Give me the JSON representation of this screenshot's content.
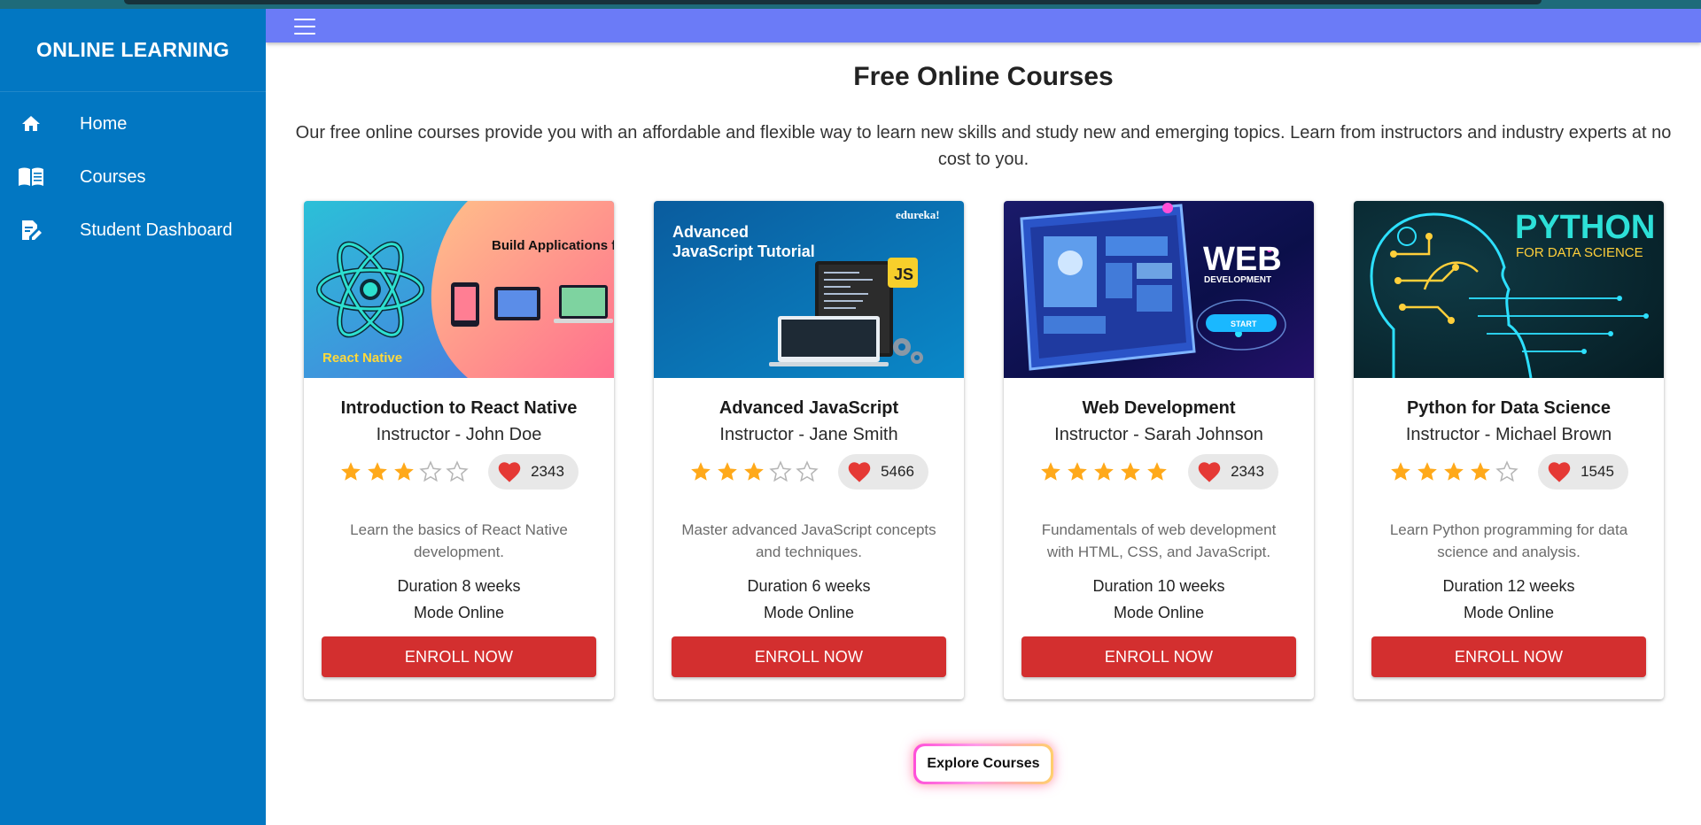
{
  "sidebar": {
    "brand": "ONLINE LEARNING",
    "items": [
      {
        "label": "Home",
        "icon": "home-icon"
      },
      {
        "label": "Courses",
        "icon": "book-icon"
      },
      {
        "label": "Student Dashboard",
        "icon": "edit-note-icon"
      }
    ]
  },
  "appbar": {
    "menu_icon": "menu-icon"
  },
  "main": {
    "title": "Free Online Courses",
    "intro": "Our free online courses provide you with an affordable and flexible way to learn new skills and study new and emerging topics. Learn from instructors and industry experts at no cost to you."
  },
  "courses": [
    {
      "title": "Introduction to React Native",
      "instructor": "Instructor - John Doe",
      "rating": 3,
      "likes": "2343",
      "description": "Learn the basics of React Native development.",
      "duration": "Duration 8 weeks",
      "mode": "Mode Online",
      "enroll_label": "ENROLL NOW",
      "image": {
        "headline": "Build Applications for",
        "caption": "React Native"
      }
    },
    {
      "title": "Advanced JavaScript",
      "instructor": "Instructor - Jane Smith",
      "rating": 3,
      "likes": "5466",
      "description": "Master advanced JavaScript concepts and techniques.",
      "duration": "Duration 6 weeks",
      "mode": "Mode Online",
      "enroll_label": "ENROLL NOW",
      "image": {
        "headline": "Advanced",
        "headline2": "JavaScript Tutorial",
        "brand": "edureka!",
        "badge": "JS"
      }
    },
    {
      "title": "Web Development",
      "instructor": "Instructor - Sarah Johnson",
      "rating": 5,
      "likes": "2343",
      "description": "Fundamentals of web development with HTML, CSS, and JavaScript.",
      "duration": "Duration 10 weeks",
      "mode": "Mode Online",
      "enroll_label": "ENROLL NOW",
      "image": {
        "headline": "WEB",
        "subline": "DEVELOPMENT",
        "button": "START"
      }
    },
    {
      "title": "Python for Data Science",
      "instructor": "Instructor - Michael Brown",
      "rating": 4,
      "likes": "1545",
      "description": "Learn Python programming for data science and analysis.",
      "duration": "Duration 12 weeks",
      "mode": "Mode Online",
      "enroll_label": "ENROLL NOW",
      "image": {
        "headline": "PYTHON",
        "subline": "FOR DATA SCIENCE"
      }
    }
  ],
  "explore_label": "Explore Courses",
  "colors": {
    "sidebar": "#0277c2",
    "appbar": "#6b7bf7",
    "enroll": "#d32f2f",
    "star": "#ffa91a",
    "heart": "#e53935"
  }
}
